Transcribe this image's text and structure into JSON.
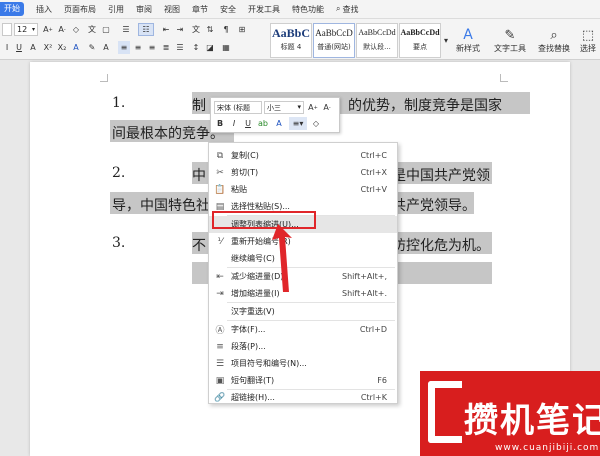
{
  "tabs": {
    "start": "开始",
    "items": [
      "插入",
      "页面布局",
      "引用",
      "审阅",
      "视图",
      "章节",
      "安全",
      "开发工具",
      "特色功能"
    ],
    "search": "查找"
  },
  "ribbon": {
    "font_size": "12",
    "styles": [
      {
        "preview": "AaBbC",
        "label": "标题 4"
      },
      {
        "preview": "AaBbCcD",
        "label": "普通(网站)"
      },
      {
        "preview": "AaBbCcDd",
        "label": "默认段..."
      },
      {
        "preview": "AaBbCcDd",
        "label": "要点"
      }
    ],
    "new_style": "新样式",
    "text_tools": "文字工具",
    "find_replace": "查找替换",
    "select": "选择"
  },
  "document": {
    "p1_num": "1.",
    "p1_line1_a": "制",
    "p1_line1_b": "的优势，制度竞争是国家",
    "p1_line2": "间最根本的竞争。",
    "p2_num": "2.",
    "p2_line1_a": "中",
    "p2_line1_b": "是中国共产党领",
    "p2_line2_a": "导，中国特色社",
    "p2_line2_b": "共产党领导。",
    "p3_num": "3.",
    "p3_line1_a": "不",
    "p3_line1_b": "防控化危为机。"
  },
  "mini_toolbar": {
    "font": "宋体 (标题",
    "size": "小三"
  },
  "context_menu": [
    {
      "icon": "copy-icon",
      "label": "复制(C)",
      "shortcut": "Ctrl+C"
    },
    {
      "icon": "cut-icon",
      "label": "剪切(T)",
      "shortcut": "Ctrl+X"
    },
    {
      "icon": "paste-icon",
      "label": "粘贴",
      "shortcut": "Ctrl+V"
    },
    {
      "icon": "paste-special-icon",
      "label": "选择性粘贴(S)...",
      "shortcut": ""
    },
    {
      "icon": "",
      "label": "调整列表缩进(U)...",
      "shortcut": ""
    },
    {
      "icon": "restart-numbering-icon",
      "label": "重新开始编号(R)",
      "shortcut": ""
    },
    {
      "icon": "",
      "label": "继续编号(C)",
      "shortcut": ""
    },
    {
      "icon": "decrease-indent-icon",
      "label": "减少缩进量(D)",
      "shortcut": "Shift+Alt+,"
    },
    {
      "icon": "increase-indent-icon",
      "label": "增加缩进量(I)",
      "shortcut": "Shift+Alt+."
    },
    {
      "icon": "",
      "label": "汉字重选(V)",
      "shortcut": ""
    },
    {
      "icon": "font-icon",
      "label": "字体(F)...",
      "shortcut": "Ctrl+D"
    },
    {
      "icon": "paragraph-icon",
      "label": "段落(P)...",
      "shortcut": ""
    },
    {
      "icon": "bullets-numbering-icon",
      "label": "项目符号和编号(N)...",
      "shortcut": ""
    },
    {
      "icon": "translate-icon",
      "label": "短句翻译(T)",
      "shortcut": "F6"
    },
    {
      "icon": "hyperlink-icon",
      "label": "超链接(H)...",
      "shortcut": "Ctrl+K"
    }
  ],
  "watermark": {
    "text": "攒机笔记",
    "url": "www.cuanjibiji.com"
  },
  "colors": {
    "accent": "#3b7ae8",
    "highlight": "#c6c6c6",
    "annotation_red": "#e0262a",
    "watermark_red": "#d81e1e"
  }
}
